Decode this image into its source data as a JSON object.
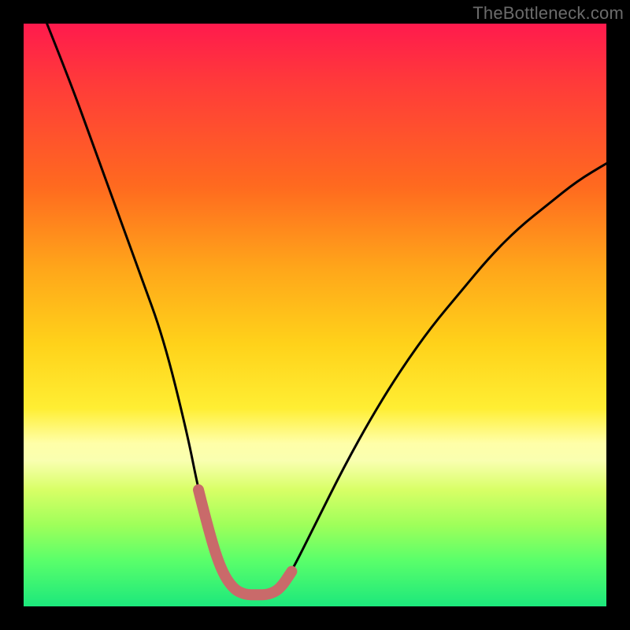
{
  "watermark": "TheBottleneck.com",
  "colors": {
    "frame": "#000000",
    "curve_main": "#000000",
    "curve_highlight": "#c96a6a"
  },
  "chart_data": {
    "type": "line",
    "title": "",
    "xlabel": "",
    "ylabel": "",
    "xlim": [
      0,
      100
    ],
    "ylim": [
      0,
      100
    ],
    "series": [
      {
        "name": "bottleneck-curve",
        "x": [
          4,
          8,
          12,
          16,
          20,
          24,
          28,
          30,
          32,
          34,
          36,
          38,
          40,
          42,
          44,
          46,
          50,
          55,
          60,
          65,
          70,
          75,
          80,
          85,
          90,
          95,
          100
        ],
        "y": [
          100,
          90,
          79,
          68,
          57,
          46,
          30,
          20,
          12,
          6,
          3,
          2,
          2,
          2,
          3,
          6,
          14,
          24,
          33,
          41,
          48,
          54,
          60,
          65,
          69,
          73,
          76
        ]
      },
      {
        "name": "highlight-valley",
        "x": [
          30,
          32,
          34,
          36,
          38,
          40,
          42,
          44,
          46
        ],
        "y": [
          20,
          12,
          6,
          3,
          2,
          2,
          2,
          3,
          6
        ]
      }
    ]
  }
}
